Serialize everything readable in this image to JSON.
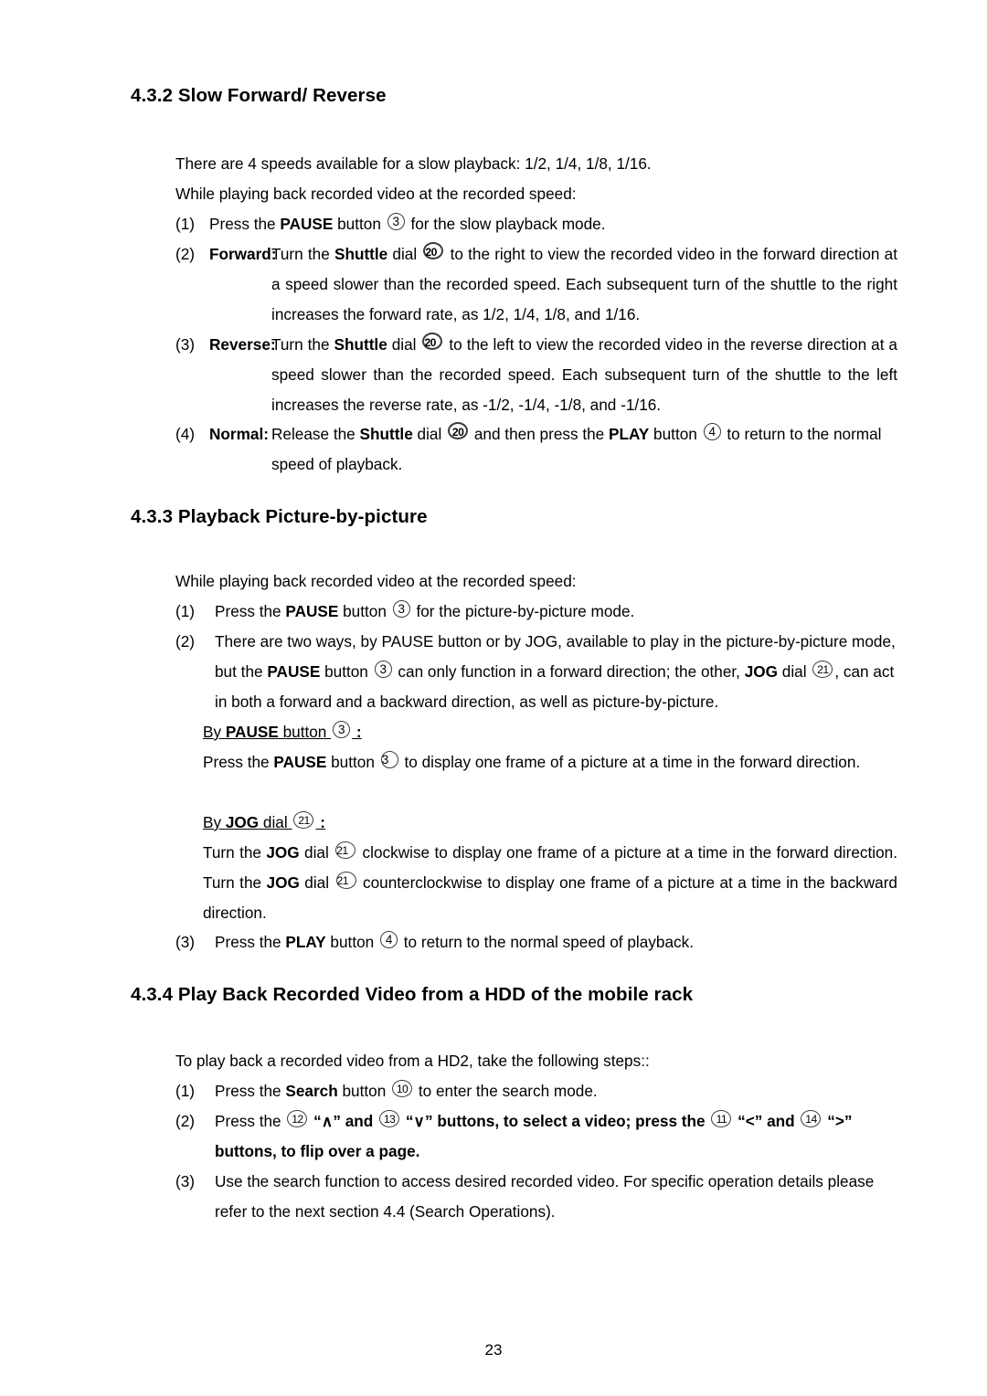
{
  "document": {
    "page_number": "23"
  },
  "sections": [
    {
      "id": "4.3.2",
      "heading": "4.3.2 Slow Forward/ Reverse",
      "intro_lines": [
        "There are 4 speeds available for a slow playback: 1/2, 1/4, 1/8, 1/16.",
        "While playing back recorded video at the recorded speed:"
      ],
      "items": [
        {
          "marker": "(1)",
          "lead": "",
          "text_before": "Press the ",
          "bold1": "PAUSE",
          "text_mid": " button ",
          "circle": "3",
          "text_after": " for the slow playback mode."
        },
        {
          "marker": "(2)",
          "lead": "Forward:",
          "body": "Turn the Shuttle dial 20 to the right to view the recorded video in the forward direction at a speed slower than the recorded speed. Each subsequent turn of the shuttle to the right increases the forward rate, as 1/2, 1/4, 1/8, and 1/16."
        },
        {
          "marker": "(3)",
          "lead": "Reverse:",
          "body": "Turn the Shuttle dial 20 to the left to view the recorded video in the reverse direction at a speed slower than the recorded speed. Each subsequent turn of the shuttle to the left increases the reverse rate, as -1/2, -1/4, -1/8, and -1/16."
        },
        {
          "marker": "(4)",
          "lead": "Normal:",
          "body": "Release the Shuttle dial 20 and then press the PLAY button 4 to return to the normal speed of playback."
        }
      ]
    },
    {
      "id": "4.3.3",
      "heading": "4.3.3 Playback Picture-by-picture",
      "intro_lines": [
        "While playing back recorded video at the recorded speed:"
      ],
      "items": [
        {
          "marker": "(1)",
          "body": "Press the PAUSE button 3 for the picture-by-picture mode."
        },
        {
          "marker": "(2)",
          "body": "There are two ways, by PAUSE button or by JOG, available to play in the picture-by-picture mode, but the PAUSE button 3 can only function in a forward direction; the other, JOG dial 21, can act in both a forward and a backward direction, as well as picture-by-picture.",
          "sub_blocks": [
            {
              "head": "By PAUSE button 3 :",
              "body": "Press the PAUSE button 3 to display one frame of a picture at a time in the forward direction."
            },
            {
              "head": "By JOG dial 21 :",
              "body": "Turn the JOG dial 21 clockwise to display one frame of a picture at a time in the forward direction. Turn the JOG dial 21 counterclockwise to display one frame of a picture at a time in the backward direction."
            }
          ]
        },
        {
          "marker": "(3)",
          "body": "Press the PLAY button 4 to return to the normal speed of playback."
        }
      ]
    },
    {
      "id": "4.3.4",
      "heading": "4.3.4 Play Back Recorded Video from a HDD of the mobile rack",
      "intro_lines": [
        "To play back a recorded video from a HD2, take the following steps::"
      ],
      "items": [
        {
          "marker": "(1)",
          "body": "Press the Search button 10 to enter the search mode."
        },
        {
          "marker": "(2)",
          "body": "Press the 12 “∧” and 13 “∨” buttons, to select a video; press the 11 “<” and 14 “>” buttons, to flip over a page."
        },
        {
          "marker": "(3)",
          "body": "Use the search function to access desired recorded video. For specific operation details please refer to the next section 4.4 (Search Operations)."
        }
      ]
    }
  ],
  "text": {
    "s432": {
      "intro1": "There are 4 speeds available for a slow playback: 1/2, 1/4, 1/8, 1/16.",
      "intro2": "While playing back recorded video at the recorded speed:",
      "i1_m": "(1)",
      "i1_a": "Press the ",
      "i1_b": "PAUSE",
      "i1_c": " button ",
      "i1_n": "3",
      "i1_d": " for the slow playback mode.",
      "i2_m": "(2)",
      "i2_lead": "Forward:",
      "i2_a": "Turn the ",
      "i2_b": "Shuttle",
      "i2_c": " dial ",
      "i2_n": "20",
      "i2_d": " to the right to view the recorded video in the forward direction at a speed slower than the recorded speed. Each subsequent turn of the shuttle to the right increases the forward rate, as 1/2, 1/4, 1/8, and 1/16.",
      "i3_m": "(3)",
      "i3_lead": "Reverse:",
      "i3_a": "Turn the ",
      "i3_b": "Shuttle",
      "i3_c": " dial ",
      "i3_n": "20",
      "i3_d": " to the left to view the recorded video in the reverse direction at a speed slower than the recorded speed. Each subsequent turn of the shuttle to the left increases the reverse rate, as -1/2, -1/4, -1/8, and -1/16.",
      "i4_m": "(4)",
      "i4_lead": "Normal:",
      "i4_a": "Release the ",
      "i4_b": "Shuttle",
      "i4_c": " dial ",
      "i4_n1": "20",
      "i4_d": " and then press the ",
      "i4_e": "PLAY",
      "i4_f": " button ",
      "i4_n2": "4",
      "i4_g": " to return to the normal speed of playback."
    },
    "s433": {
      "intro1": "While playing back recorded video at the recorded speed:",
      "i1_m": "(1)",
      "i1_a": "Press the ",
      "i1_b": "PAUSE",
      "i1_c": " button ",
      "i1_n": "3",
      "i1_d": " for the picture-by-picture mode.",
      "i2_m": "(2)",
      "i2_a": "There are two ways, by PAUSE button or by JOG, available to play in the picture-by-picture mode, but the ",
      "i2_b": "PAUSE",
      "i2_c": " button ",
      "i2_n1": "3",
      "i2_d": " can only function in a forward direction; the other, ",
      "i2_e": "JOG",
      "i2_f": " dial ",
      "i2_n2": "21",
      "i2_g": ", can act in both a forward and a backward direction, as well as picture-by-picture.",
      "sub1_h1": "By ",
      "sub1_h2": "PAUSE",
      "sub1_h3": " button ",
      "sub1_hn": "3",
      "sub1_h4": " :",
      "sub1_a": "Press the ",
      "sub1_b": "PAUSE",
      "sub1_c": " button ",
      "sub1_n": "3",
      "sub1_d": " to display one frame of a picture at a time in the forward direction.",
      "sub2_h1": "By ",
      "sub2_h2": "JOG",
      "sub2_h3": " dial ",
      "sub2_hn": "21",
      "sub2_h4": " :",
      "sub2_a": "Turn the ",
      "sub2_b": "JOG",
      "sub2_c": " dial ",
      "sub2_n1": "21",
      "sub2_d": " clockwise to display one frame of a picture at a time in the forward direction. Turn the ",
      "sub2_e": "JOG",
      "sub2_f": " dial ",
      "sub2_n2": "21",
      "sub2_g": " counterclockwise to display one frame of a picture at a time in the backward direction.",
      "i3_m": "(3)",
      "i3_a": "Press the ",
      "i3_b": "PLAY",
      "i3_c": " button ",
      "i3_n": "4",
      "i3_d": " to return to the normal speed of playback."
    },
    "s434": {
      "intro1": "To play back a recorded video from a HD2, take the following steps::",
      "i1_m": "(1)",
      "i1_a": "Press the ",
      "i1_b": "Search",
      "i1_c": " button ",
      "i1_n": "10",
      "i1_d": " to enter the search mode.",
      "i2_m": "(2)",
      "i2_a": "Press the ",
      "i2_n1": "12",
      "i2_b": " “∧” and ",
      "i2_n2": "13",
      "i2_c": " “∨” buttons, to select a video; press the ",
      "i2_n3": "11",
      "i2_d": " “<” and ",
      "i2_n4": "14",
      "i2_e": " “>” buttons, to flip over a page.",
      "i3_m": "(3)",
      "i3_a": "Use the search function to access desired recorded video. For specific operation details please refer to the next section 4.4 (Search Operations)."
    }
  },
  "headings": {
    "h432": "4.3.2 Slow Forward/ Reverse",
    "h433": "4.3.3 Playback Picture-by-picture",
    "h434": "4.3.4 Play Back Recorded Video from a HDD of the mobile rack"
  }
}
